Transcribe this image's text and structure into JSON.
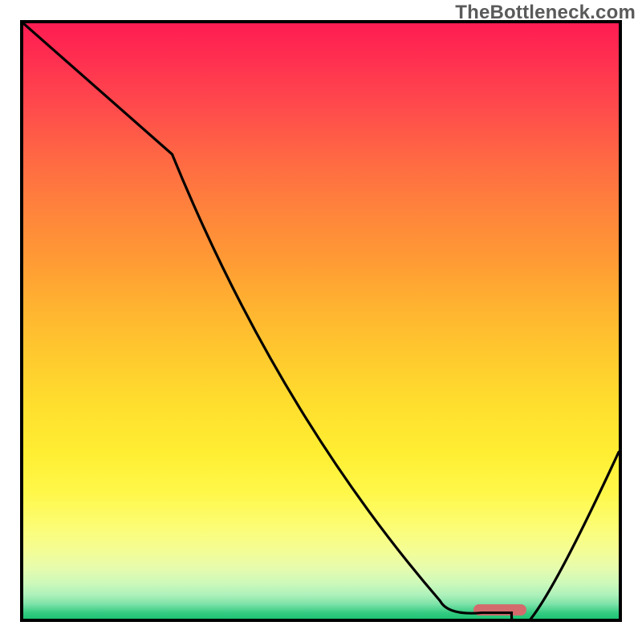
{
  "watermark": "TheBottleneck.com",
  "chart_data": {
    "type": "line",
    "title": "",
    "xlabel": "",
    "ylabel": "",
    "xlim": [
      0,
      100
    ],
    "ylim": [
      0,
      100
    ],
    "legend": false,
    "grid": false,
    "series": [
      {
        "name": "bottleneck-curve",
        "x": [
          0,
          25,
          70,
          77,
          82,
          100
        ],
        "values": [
          100,
          78,
          3,
          1,
          1,
          28
        ]
      }
    ],
    "annotations": [
      {
        "name": "optimal-marker",
        "shape": "pill",
        "x": 80,
        "y": 1.5,
        "color": "#d36b6d"
      }
    ],
    "background_gradient_stops": [
      {
        "y": 100,
        "color": "#ff1c52"
      },
      {
        "y": 60,
        "color": "#ff9b34"
      },
      {
        "y": 30,
        "color": "#ffee32"
      },
      {
        "y": 10,
        "color": "#e6fcad"
      },
      {
        "y": 0,
        "color": "#1ec373"
      }
    ]
  }
}
